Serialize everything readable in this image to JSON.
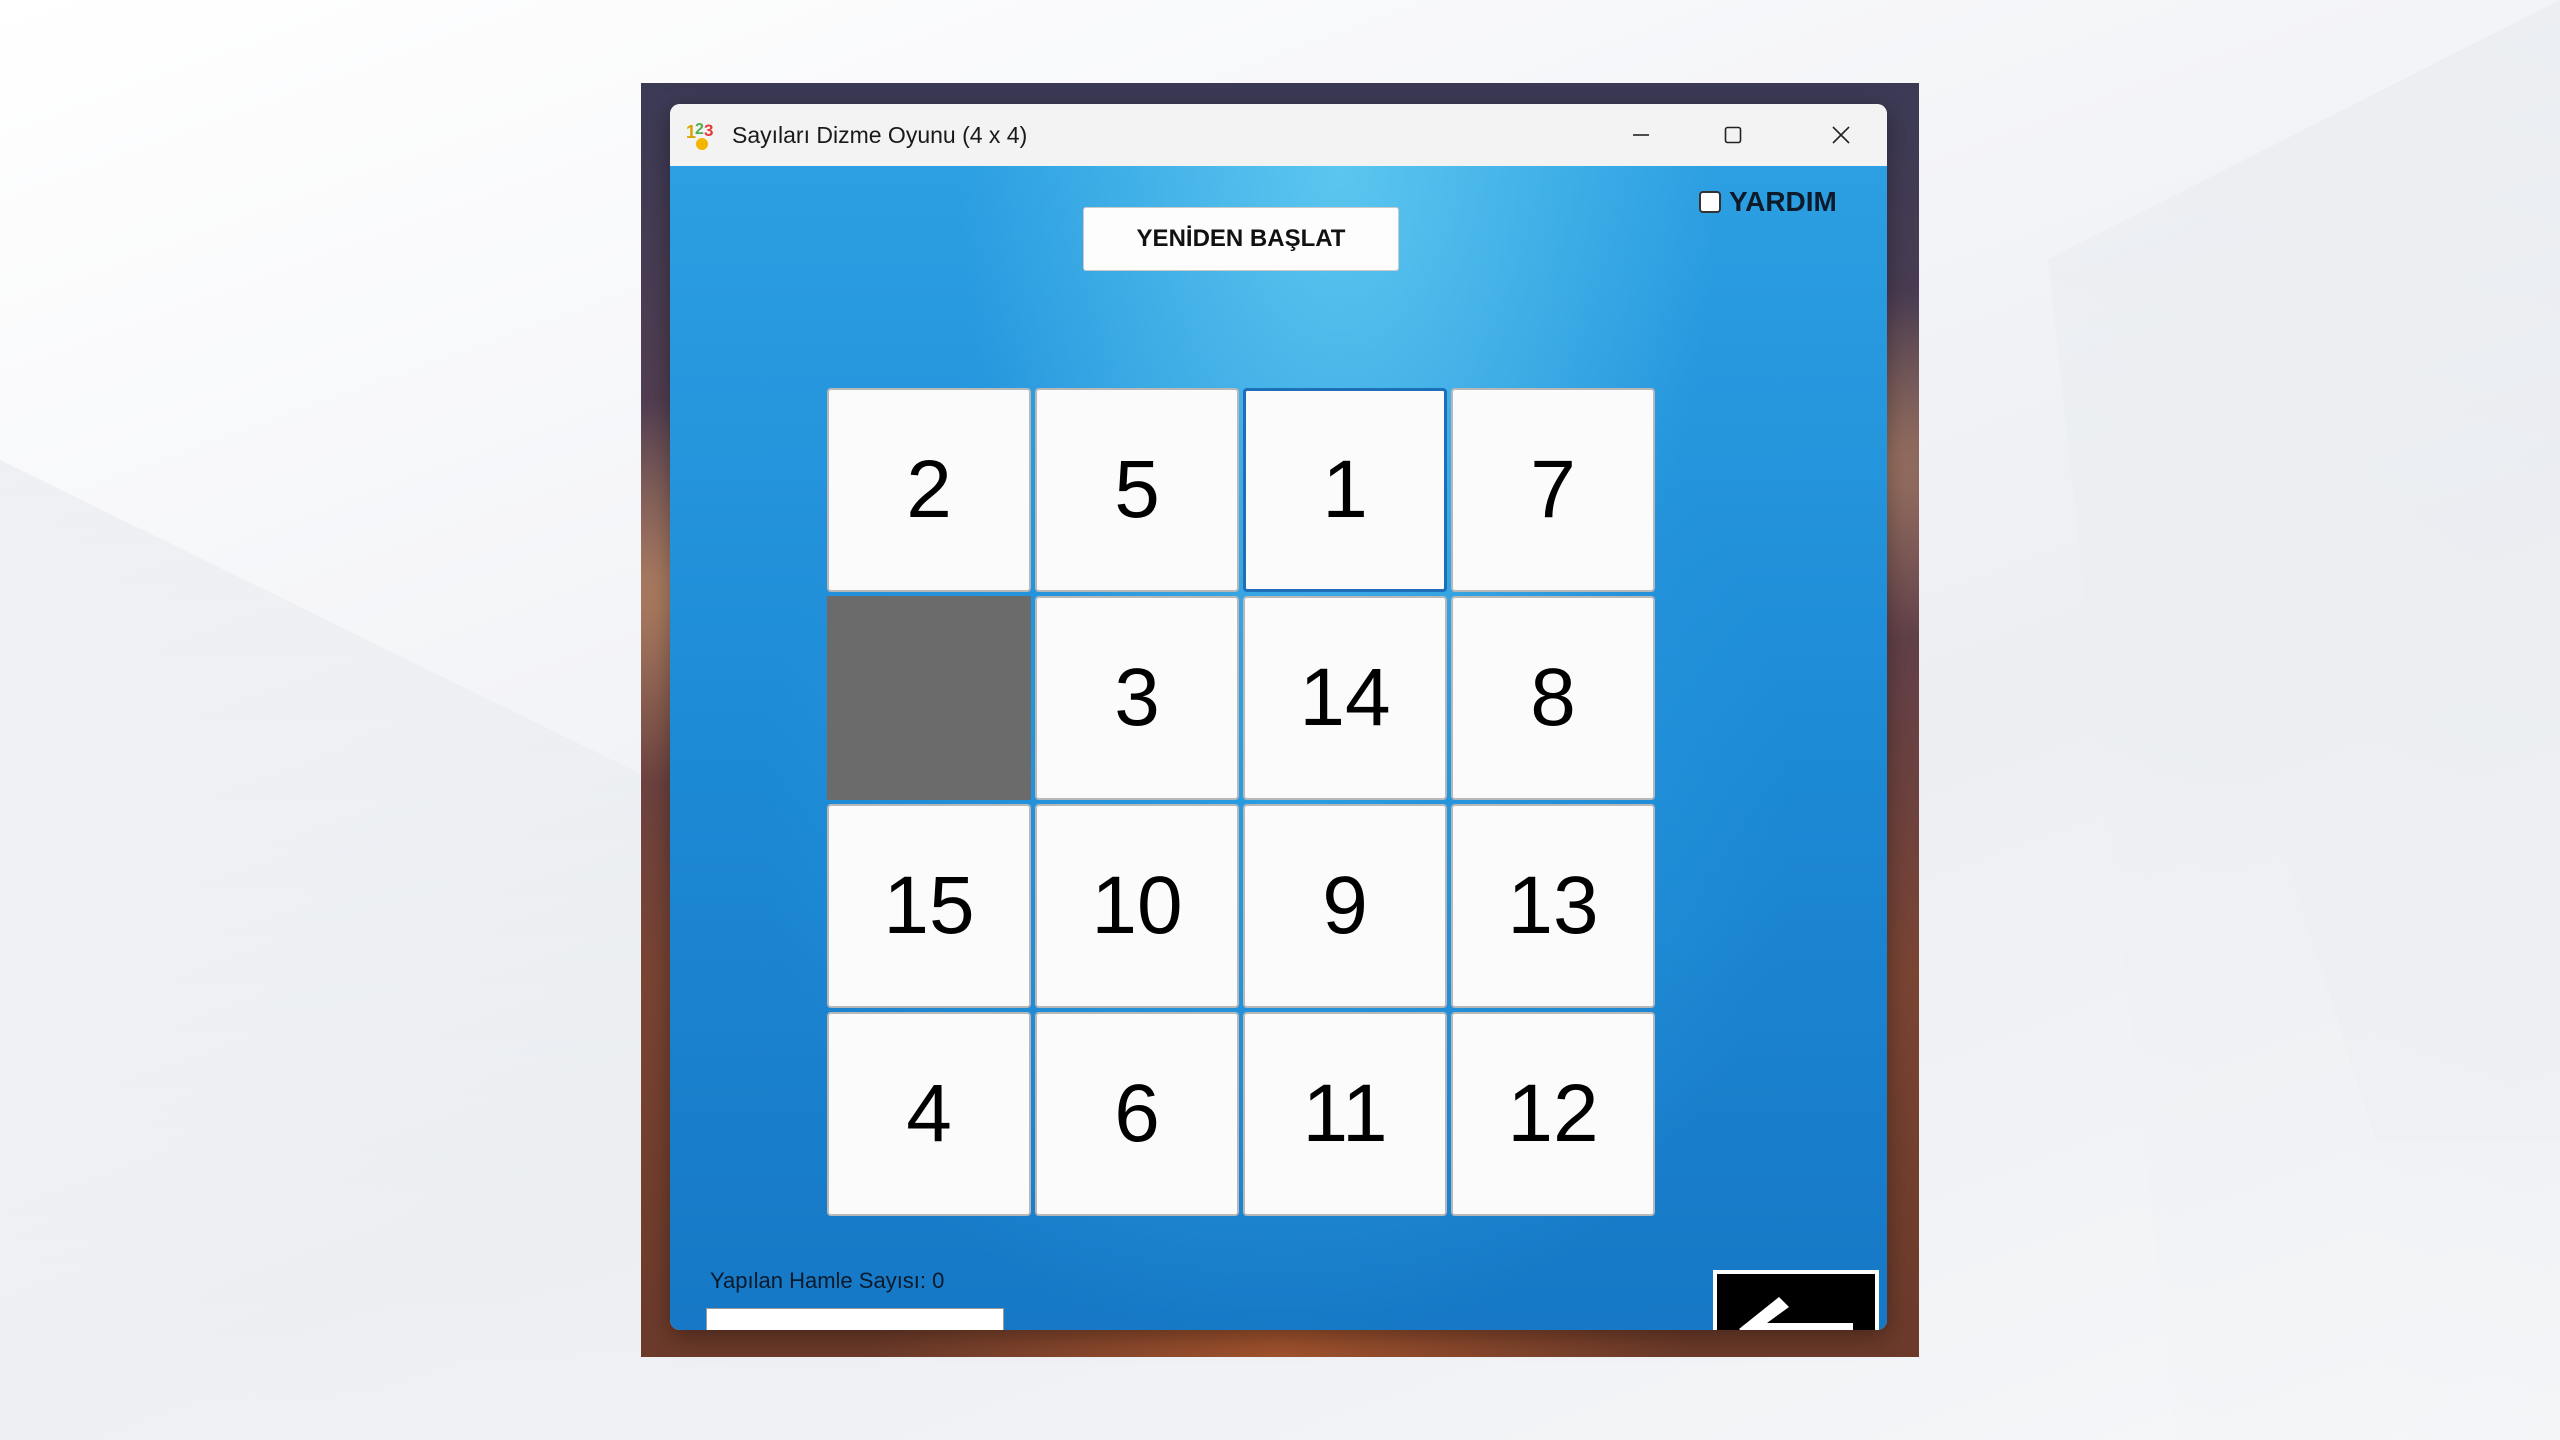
{
  "window": {
    "title": "Sayıları Dizme Oyunu (4 x 4)"
  },
  "help": {
    "label": "YARDIM",
    "checked": false
  },
  "toolbar": {
    "restart_label": "YENİDEN BAŞLAT"
  },
  "board": {
    "size": "4 x 4",
    "tiles": [
      "2",
      "5",
      "1",
      "7",
      "",
      "3",
      "14",
      "8",
      "15",
      "10",
      "9",
      "13",
      "4",
      "6",
      "11",
      "12"
    ],
    "empty_index": 4,
    "focused_index": 2
  },
  "status": {
    "moves_label": "Yapılan Hamle Sayısı: 0",
    "moves": 0
  },
  "name_input": {
    "value": ""
  },
  "icons": {
    "app": "app-123-icon",
    "minimize": "minimize-icon",
    "maximize": "maximize-icon",
    "close": "close-icon",
    "trash": "trash-icon",
    "back": "arrow-left-icon"
  },
  "colors": {
    "client_blue": "#1d8ad6",
    "empty_tile": "#6b6b6b",
    "focus_border": "#1f6fb8",
    "trash_red": "#c8102e"
  }
}
